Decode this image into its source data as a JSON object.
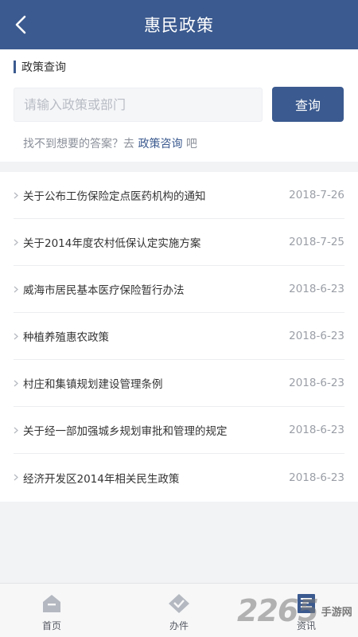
{
  "header": {
    "title": "惠民政策"
  },
  "search": {
    "section_title": "政策查询",
    "placeholder": "请输入政策或部门",
    "button_label": "查询",
    "hint_prefix": "找不到想要的答案？去 ",
    "hint_link": "政策咨询",
    "hint_suffix": " 吧"
  },
  "policies": [
    {
      "title": "关于公布工伤保险定点医药机构的通知",
      "date": "2018-7-26"
    },
    {
      "title": "关于2014年度农村低保认定实施方案",
      "date": "2018-7-25"
    },
    {
      "title": "威海市居民基本医疗保险暂行办法",
      "date": "2018-6-23"
    },
    {
      "title": "种植养殖惠农政策",
      "date": "2018-6-23"
    },
    {
      "title": "村庄和集镇规划建设管理条例",
      "date": "2018-6-23"
    },
    {
      "title": "关于经一部加强城乡规划审批和管理的规定",
      "date": "2018-6-23"
    },
    {
      "title": "经济开发区2014年相关民生政策",
      "date": "2018-6-23"
    }
  ],
  "tabbar": {
    "tabs": [
      {
        "label": "首页",
        "icon": "home-icon"
      },
      {
        "label": "办件",
        "icon": "diamond-icon"
      },
      {
        "label": "资讯",
        "icon": "news-icon",
        "active": true
      }
    ]
  },
  "watermark": {
    "number": "2265",
    "text": "手游网"
  },
  "colors": {
    "primary": "#3b5a8f",
    "background": "#f2f3f5"
  }
}
